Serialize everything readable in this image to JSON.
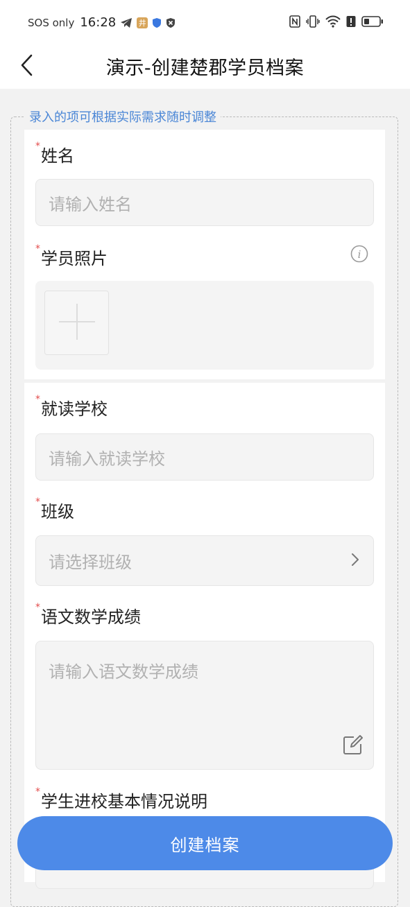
{
  "status_bar": {
    "carrier": "SOS only",
    "time": "16:28",
    "app_badge": "井"
  },
  "header": {
    "title": "演示-创建楚郡学员档案"
  },
  "form": {
    "legend": "录入的项可根据实际需求随时调整",
    "required_mark": "*",
    "name": {
      "label": "姓名",
      "placeholder": "请输入姓名"
    },
    "photo": {
      "label": "学员照片"
    },
    "school": {
      "label": "就读学校",
      "placeholder": "请输入就读学校"
    },
    "class": {
      "label": "班级",
      "placeholder": "请选择班级"
    },
    "scores": {
      "label": "语文数学成绩",
      "placeholder": "请输入语文数学成绩"
    },
    "intro": {
      "label": "学生进校基本情况说明"
    }
  },
  "submit_label": "创建档案",
  "colors": {
    "accent": "#4d8ae8",
    "legend": "#4a86d6",
    "required": "#e34d4d"
  }
}
